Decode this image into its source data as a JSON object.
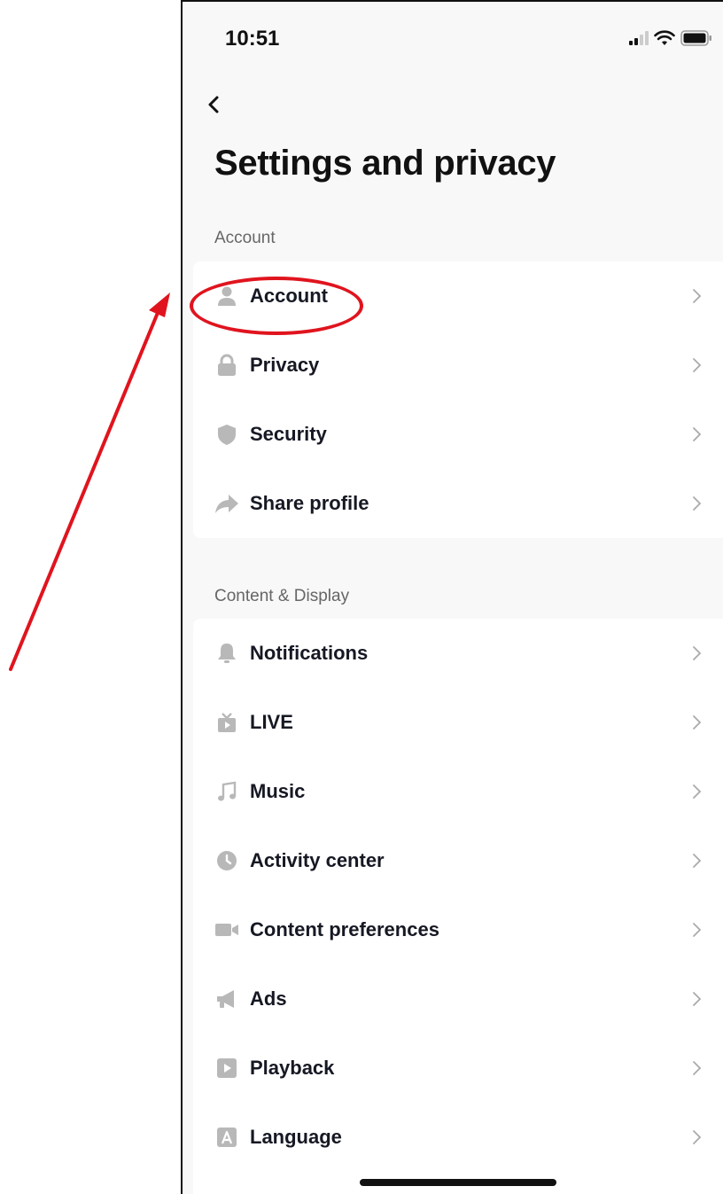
{
  "status_bar": {
    "time": "10:51"
  },
  "page": {
    "title": "Settings and privacy"
  },
  "sections": [
    {
      "header": "Account",
      "items": [
        {
          "label": "Account",
          "icon": "person-icon"
        },
        {
          "label": "Privacy",
          "icon": "lock-icon"
        },
        {
          "label": "Security",
          "icon": "shield-icon"
        },
        {
          "label": "Share profile",
          "icon": "share-arrow-icon"
        }
      ]
    },
    {
      "header": "Content & Display",
      "items": [
        {
          "label": "Notifications",
          "icon": "bell-icon"
        },
        {
          "label": "LIVE",
          "icon": "tv-icon"
        },
        {
          "label": "Music",
          "icon": "music-note-icon"
        },
        {
          "label": "Activity center",
          "icon": "clock-icon"
        },
        {
          "label": "Content preferences",
          "icon": "video-camera-icon"
        },
        {
          "label": "Ads",
          "icon": "megaphone-icon"
        },
        {
          "label": "Playback",
          "icon": "play-square-icon"
        },
        {
          "label": "Language",
          "icon": "letter-a-icon"
        }
      ]
    }
  ],
  "colors": {
    "icon_gray": "#b8b8b8",
    "annotation_red": "#e0141e",
    "text": "#161823",
    "section_text": "#666666"
  }
}
